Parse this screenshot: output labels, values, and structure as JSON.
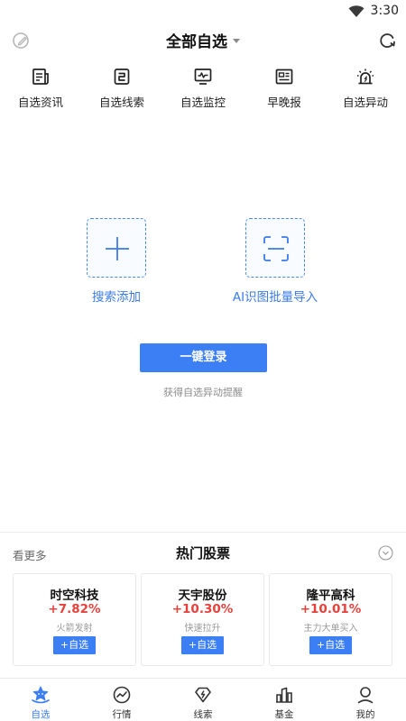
{
  "status_bar": {
    "time": "3:30",
    "wifi_icon": "wifi-icon"
  },
  "header": {
    "title": "全部自选",
    "left_icon": "edit-icon",
    "right_icon": "refresh-icon"
  },
  "quick_nav": [
    {
      "label": "自选资讯",
      "icon": "news-icon"
    },
    {
      "label": "自选线索",
      "icon": "clue-icon"
    },
    {
      "label": "自选监控",
      "icon": "monitor-icon"
    },
    {
      "label": "早晚报",
      "icon": "report-icon"
    },
    {
      "label": "自选异动",
      "icon": "alarm-icon"
    }
  ],
  "empty_state": {
    "search_add_label": "搜索添加",
    "ai_import_label": "AI识图批量导入",
    "login_button": "一键登录",
    "login_hint": "获得自选异动提醒"
  },
  "hot_stocks": {
    "see_more": "看更多",
    "title": "热门股票",
    "cards": [
      {
        "name": "时空科技",
        "change": "+7.82%",
        "tag": "火箭发射",
        "add": "+自选"
      },
      {
        "name": "天宇股份",
        "change": "+10.30%",
        "tag": "快速拉升",
        "add": "+自选"
      },
      {
        "name": "隆平高科",
        "change": "+10.01%",
        "tag": "主力大单买入",
        "add": "+自选"
      }
    ]
  },
  "tab_bar": [
    {
      "label": "自选",
      "icon": "watchlist-icon",
      "active": true
    },
    {
      "label": "行情",
      "icon": "market-icon",
      "active": false
    },
    {
      "label": "线索",
      "icon": "clue-diamond-icon",
      "active": false
    },
    {
      "label": "基金",
      "icon": "fund-icon",
      "active": false
    },
    {
      "label": "我的",
      "icon": "profile-icon",
      "active": false
    }
  ],
  "colors": {
    "accent": "#3c7ef3",
    "rise": "#e8413b"
  }
}
